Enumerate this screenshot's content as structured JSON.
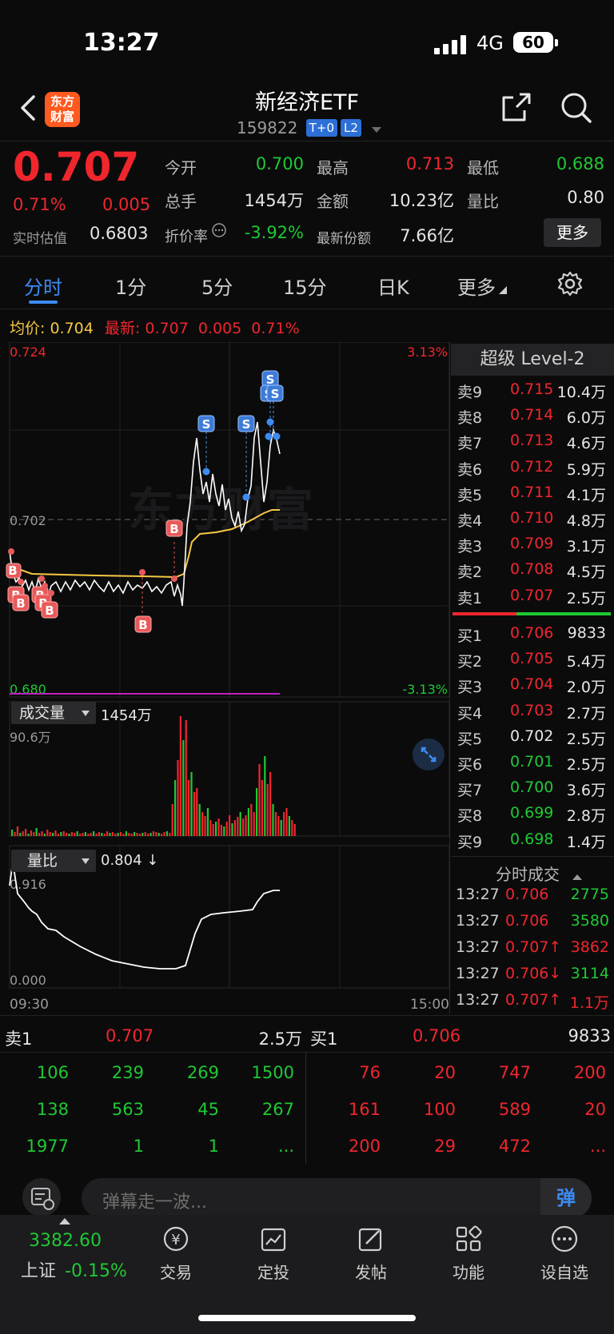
{
  "status": {
    "time": "13:27",
    "network": "4G",
    "battery": "60"
  },
  "header": {
    "logo_text": [
      "东方",
      "财富"
    ],
    "title": "新经济ETF",
    "code": "159822",
    "tags": [
      "T+0",
      "L2"
    ]
  },
  "quote": {
    "price": "0.707",
    "change_pct": "0.71%",
    "change": "0.005",
    "est_label": "实时估值",
    "est_value": "0.6803",
    "fields": [
      {
        "label": "今开",
        "value": "0.700",
        "color": "green"
      },
      {
        "label": "最高",
        "value": "0.713",
        "color": "red"
      },
      {
        "label": "最低",
        "value": "0.688",
        "color": "green"
      },
      {
        "label": "总手",
        "value": "1454万",
        "color": "white"
      },
      {
        "label": "金额",
        "value": "10.23亿",
        "color": "white"
      },
      {
        "label": "量比",
        "value": "0.80",
        "color": "white"
      },
      {
        "label": "折价率",
        "value": "-3.92%",
        "color": "green"
      },
      {
        "label": "最新份额",
        "value": "7.66亿",
        "color": "white"
      }
    ],
    "more_button": "更多"
  },
  "tabs": [
    "分时",
    "1分",
    "5分",
    "15分",
    "日K",
    "更多"
  ],
  "chart_legend": {
    "avg_label": "均价:",
    "avg_value": "0.704",
    "last_label": "最新:",
    "last_value": "0.707",
    "change": "0.005",
    "change_pct": "0.71%"
  },
  "chart": {
    "y_max": "0.724",
    "y_mid": "0.702",
    "y_min": "0.680",
    "pct_max": "3.13%",
    "pct_min": "-3.13%",
    "x_start": "09:30",
    "x_end": "15:00",
    "watermark": "东方财富",
    "marker_b": "B",
    "marker_s": "S"
  },
  "chart_data": [
    {
      "type": "line",
      "title": "",
      "y_range": [
        0.68,
        0.724
      ],
      "x_range": [
        "09:30",
        "15:00"
      ],
      "series": [
        {
          "name": "最新",
          "color": "#ffffff",
          "x": [
            "09:30",
            "09:35",
            "09:45",
            "10:00",
            "10:15",
            "10:30",
            "10:45",
            "11:00",
            "11:15",
            "11:30",
            "13:00",
            "13:05",
            "13:10",
            "13:15",
            "13:20",
            "13:25",
            "13:27"
          ],
          "values": [
            0.691,
            0.689,
            0.688,
            0.69,
            0.689,
            0.689,
            0.689,
            0.689,
            0.689,
            0.688,
            0.71,
            0.706,
            0.703,
            0.71,
            0.705,
            0.708,
            0.707
          ]
        },
        {
          "name": "均价",
          "color": "#f5c842",
          "x": [
            "09:30",
            "10:00",
            "10:30",
            "11:00",
            "11:30",
            "13:00",
            "13:05",
            "13:10",
            "13:20",
            "13:27"
          ],
          "values": [
            0.692,
            0.6915,
            0.691,
            0.691,
            0.69,
            0.701,
            0.702,
            0.702,
            0.703,
            0.704
          ]
        }
      ]
    },
    {
      "type": "bar",
      "title": "",
      "ylabel": "成交量",
      "max_label": "90.6万",
      "total": "1454万"
    },
    {
      "type": "line",
      "title": "",
      "ylabel": "量比",
      "current": "0.804",
      "y_range": [
        0.0,
        0.916
      ]
    }
  ],
  "volume_panel": {
    "label": "成交量",
    "total": "1454万",
    "max": "90.6万"
  },
  "ratio_panel": {
    "label": "量比",
    "value": "0.804 ↓",
    "max": "0.916",
    "min": "0.000"
  },
  "orderbook": {
    "title": "超级 Level-2",
    "asks": [
      {
        "name": "卖9",
        "price": "0.715",
        "vol": "10.4万"
      },
      {
        "name": "卖8",
        "price": "0.714",
        "vol": "6.0万"
      },
      {
        "name": "卖7",
        "price": "0.713",
        "vol": "4.6万"
      },
      {
        "name": "卖6",
        "price": "0.712",
        "vol": "5.9万"
      },
      {
        "name": "卖5",
        "price": "0.711",
        "vol": "4.1万"
      },
      {
        "name": "卖4",
        "price": "0.710",
        "vol": "4.8万"
      },
      {
        "name": "卖3",
        "price": "0.709",
        "vol": "3.1万"
      },
      {
        "name": "卖2",
        "price": "0.708",
        "vol": "4.5万"
      },
      {
        "name": "卖1",
        "price": "0.707",
        "vol": "2.5万"
      }
    ],
    "bids": [
      {
        "name": "买1",
        "price": "0.706",
        "vol": "9833",
        "color": "#f0262d"
      },
      {
        "name": "买2",
        "price": "0.705",
        "vol": "5.4万",
        "color": "#f0262d"
      },
      {
        "name": "买3",
        "price": "0.704",
        "vol": "2.0万",
        "color": "#f0262d"
      },
      {
        "name": "买4",
        "price": "0.703",
        "vol": "2.7万",
        "color": "#f0262d"
      },
      {
        "name": "买5",
        "price": "0.702",
        "vol": "2.5万",
        "color": "#e6e6e6"
      },
      {
        "name": "买6",
        "price": "0.701",
        "vol": "2.5万",
        "color": "#1fc934"
      },
      {
        "name": "买7",
        "price": "0.700",
        "vol": "3.6万",
        "color": "#1fc934"
      },
      {
        "name": "买8",
        "price": "0.699",
        "vol": "2.8万",
        "color": "#1fc934"
      },
      {
        "name": "买9",
        "price": "0.698",
        "vol": "1.4万",
        "color": "#1fc934"
      }
    ],
    "ticks_title": "分时成交",
    "ticks": [
      {
        "time": "13:27",
        "price": "0.706",
        "vol": "2775",
        "vol_color": "#1fc934"
      },
      {
        "time": "13:27",
        "price": "0.706",
        "vol": "3580",
        "vol_color": "#1fc934"
      },
      {
        "time": "13:27",
        "price": "0.707↑",
        "vol": "3862",
        "vol_color": "#f0262d"
      },
      {
        "time": "13:27",
        "price": "0.706↓",
        "vol": "3114",
        "vol_color": "#1fc934"
      },
      {
        "time": "13:27",
        "price": "0.707↑",
        "vol": "1.1万",
        "vol_color": "#f0262d"
      }
    ]
  },
  "board": {
    "sell_label": "卖1",
    "sell_price": "0.707",
    "sell_vol": "2.5万",
    "buy_label": "买1",
    "buy_price": "0.706",
    "buy_vol": "9833",
    "sell_queue": [
      [
        "106",
        "239",
        "269",
        "1500"
      ],
      [
        "138",
        "563",
        "45",
        "267"
      ],
      [
        "1977",
        "1",
        "1",
        "..."
      ]
    ],
    "buy_queue": [
      [
        "76",
        "20",
        "747",
        "200"
      ],
      [
        "161",
        "100",
        "589",
        "20"
      ],
      [
        "200",
        "29",
        "472",
        "..."
      ]
    ]
  },
  "danmu": {
    "placeholder": "弹幕走一波...",
    "send": "弹"
  },
  "bottom_nav": {
    "index_value": "3382.60",
    "index_name": "上证",
    "index_change": "-0.15%",
    "items": [
      "交易",
      "定投",
      "发帖",
      "功能",
      "设自选"
    ]
  }
}
